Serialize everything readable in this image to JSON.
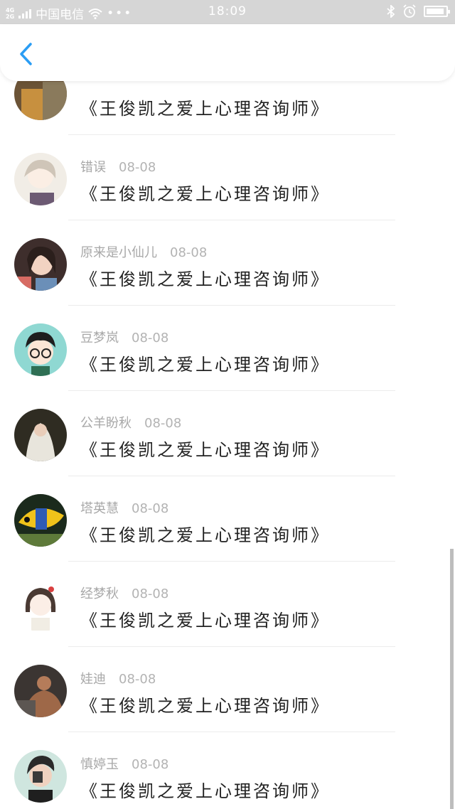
{
  "status_bar": {
    "network": "4G\n2G",
    "carrier": "中国电信",
    "time": "18:09"
  },
  "header": {
    "back_icon": "chevron-left-icon",
    "accent_color": "#2a9df4"
  },
  "messages": [
    {
      "name": "",
      "date": "",
      "title": "《王俊凯之爱上心理咨询师》",
      "avatar": "brown-photo"
    },
    {
      "name": "错误",
      "date": "08-08",
      "title": "《王俊凯之爱上心理咨询师》",
      "avatar": "anime-boy"
    },
    {
      "name": "原来是小仙儿",
      "date": "08-08",
      "title": "《王俊凯之爱上心理咨询师》",
      "avatar": "girl-photo"
    },
    {
      "name": "豆梦岚",
      "date": "08-08",
      "title": "《王俊凯之爱上心理咨询师》",
      "avatar": "cartoon-glasses"
    },
    {
      "name": "公羊盼秋",
      "date": "08-08",
      "title": "《王俊凯之爱上心理咨询师》",
      "avatar": "bride-photo"
    },
    {
      "name": "塔英慧",
      "date": "08-08",
      "title": "《王俊凯之爱上心理咨询师》",
      "avatar": "fish-photo"
    },
    {
      "name": "经梦秋",
      "date": "08-08",
      "title": "《王俊凯之爱上心理咨询师》",
      "avatar": "cartoon-girl"
    },
    {
      "name": "娃迪",
      "date": "08-08",
      "title": "《王俊凯之爱上心理咨询师》",
      "avatar": "muscle-photo"
    },
    {
      "name": "慎婷玉",
      "date": "08-08",
      "title": "《王俊凯之爱上心理咨询师》",
      "avatar": "portrait-photo"
    }
  ]
}
